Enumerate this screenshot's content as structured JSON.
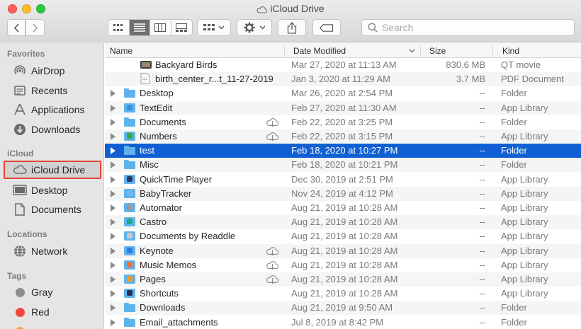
{
  "window": {
    "title": "iCloud Drive"
  },
  "toolbar": {
    "search_placeholder": "Search",
    "view_modes": [
      "icon-view",
      "list-view",
      "column-view",
      "gallery-view"
    ],
    "active_view": "list-view"
  },
  "sidebar": {
    "sections": [
      {
        "label": "Favorites",
        "items": [
          {
            "label": "AirDrop",
            "icon": "airdrop-icon"
          },
          {
            "label": "Recents",
            "icon": "recents-icon"
          },
          {
            "label": "Applications",
            "icon": "applications-icon"
          },
          {
            "label": "Downloads",
            "icon": "downloads-icon"
          }
        ]
      },
      {
        "label": "iCloud",
        "items": [
          {
            "label": "iCloud Drive",
            "icon": "cloud-icon",
            "selected": true
          },
          {
            "label": "Desktop",
            "icon": "desktop-icon"
          },
          {
            "label": "Documents",
            "icon": "documents-icon"
          }
        ]
      },
      {
        "label": "Locations",
        "items": [
          {
            "label": "Network",
            "icon": "network-icon"
          }
        ]
      },
      {
        "label": "Tags",
        "items": [
          {
            "label": "Gray",
            "color": "#8e8e8e"
          },
          {
            "label": "Red",
            "color": "#f0473f"
          }
        ]
      }
    ]
  },
  "columns": {
    "name": "Name",
    "date": "Date Modified",
    "size": "Size",
    "kind": "Kind"
  },
  "files": [
    {
      "name": "Backyard Birds",
      "date": "Mar 27, 2020 at 11:13 AM",
      "size": "830.6 MB",
      "kind": "QT movie",
      "type": "movie",
      "sub": true
    },
    {
      "name": "birth_center_r...t_11-27-2019",
      "date": "Jan 3, 2020 at 11:29 AM",
      "size": "3.7 MB",
      "kind": "PDF Document",
      "type": "pdf",
      "sub": true
    },
    {
      "name": "Desktop",
      "date": "Mar 26, 2020 at 2:54 PM",
      "size": "--",
      "kind": "Folder",
      "type": "folder"
    },
    {
      "name": "TextEdit",
      "date": "Feb 27, 2020 at 11:30 AM",
      "size": "--",
      "kind": "App Library",
      "type": "app",
      "app_color": "#3f8fd8"
    },
    {
      "name": "Documents",
      "date": "Feb 22, 2020 at 3:25 PM",
      "size": "--",
      "kind": "Folder",
      "type": "folder",
      "cloud": true
    },
    {
      "name": "Numbers",
      "date": "Feb 22, 2020 at 3:15 PM",
      "size": "--",
      "kind": "App Library",
      "type": "app",
      "cloud": true,
      "app_color": "#3aa84a"
    },
    {
      "name": "test",
      "date": "Feb 18, 2020 at 10:27 PM",
      "size": "--",
      "kind": "Folder",
      "type": "folder",
      "selected": true
    },
    {
      "name": "Misc",
      "date": "Feb 18, 2020 at 10:21 PM",
      "size": "--",
      "kind": "Folder",
      "type": "folder"
    },
    {
      "name": "QuickTime Player",
      "date": "Dec 30, 2019 at 2:51 PM",
      "size": "--",
      "kind": "App Library",
      "type": "app",
      "app_color": "#2b3d66"
    },
    {
      "name": "BabyTracker",
      "date": "Nov 24, 2019 at 4:12 PM",
      "size": "--",
      "kind": "App Library",
      "type": "app",
      "app_color": "#6fb8e8"
    },
    {
      "name": "Automator",
      "date": "Aug 21, 2019 at 10:28 AM",
      "size": "--",
      "kind": "App Library",
      "type": "app",
      "app_color": "#9a9a9a"
    },
    {
      "name": "Castro",
      "date": "Aug 21, 2019 at 10:28 AM",
      "size": "--",
      "kind": "App Library",
      "type": "app",
      "app_color": "#1fa88c"
    },
    {
      "name": "Documents by Readdle",
      "date": "Aug 21, 2019 at 10:28 AM",
      "size": "--",
      "kind": "App Library",
      "type": "app",
      "app_color": "#c9c9c9"
    },
    {
      "name": "Keynote",
      "date": "Aug 21, 2019 at 10:28 AM",
      "size": "--",
      "kind": "App Library",
      "type": "app",
      "cloud": true,
      "app_color": "#2f7fd8"
    },
    {
      "name": "Music Memos",
      "date": "Aug 21, 2019 at 10:28 AM",
      "size": "--",
      "kind": "App Library",
      "type": "app",
      "cloud": true,
      "app_color": "#f26f3d"
    },
    {
      "name": "Pages",
      "date": "Aug 21, 2019 at 10:28 AM",
      "size": "--",
      "kind": "App Library",
      "type": "app",
      "cloud": true,
      "app_color": "#f29c1f"
    },
    {
      "name": "Shortcuts",
      "date": "Aug 21, 2019 at 10:28 AM",
      "size": "--",
      "kind": "App Library",
      "type": "app",
      "app_color": "#2a2f5a"
    },
    {
      "name": "Downloads",
      "date": "Aug 21, 2019 at 9:50 AM",
      "size": "--",
      "kind": "Folder",
      "type": "folder"
    },
    {
      "name": "Email_attachments",
      "date": "Jul 8, 2019 at 8:42 PM",
      "size": "--",
      "kind": "Folder",
      "type": "folder"
    }
  ]
}
